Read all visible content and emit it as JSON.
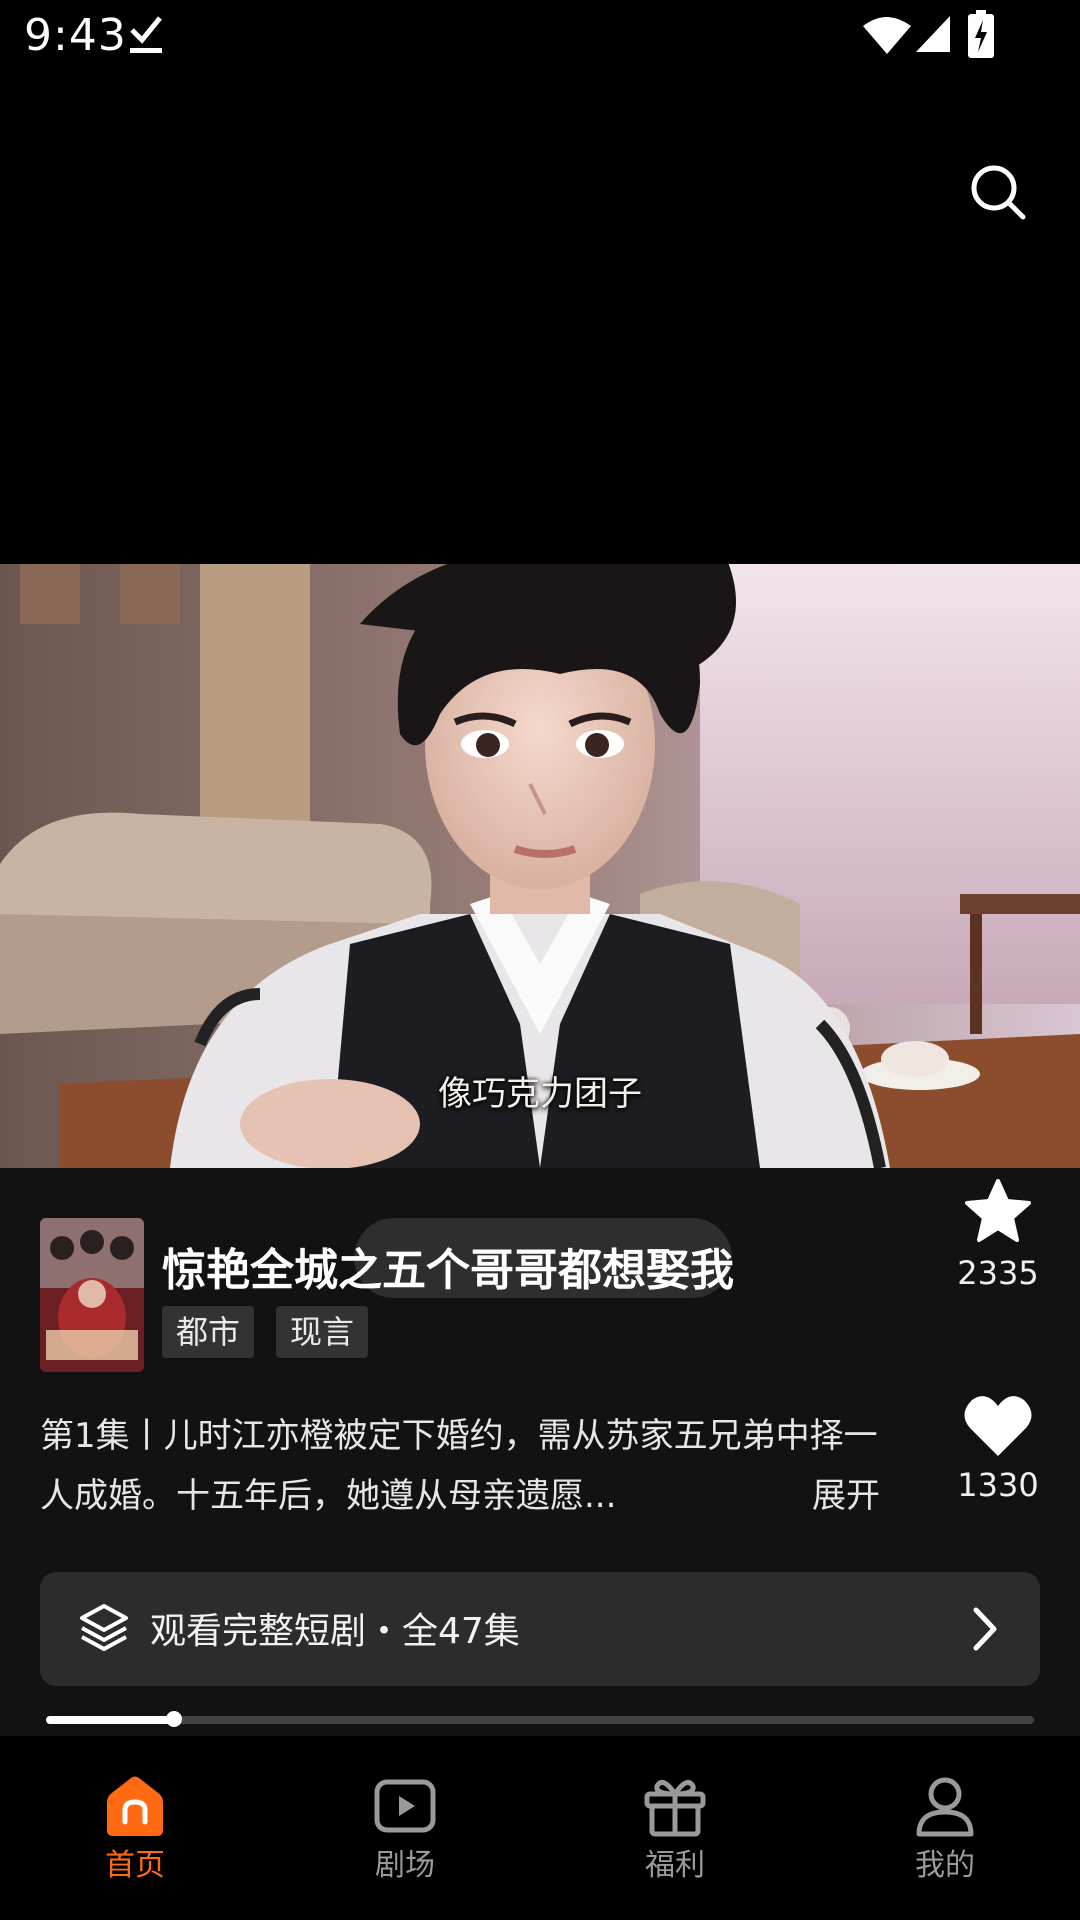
{
  "status_bar": {
    "time": "9:43"
  },
  "video": {
    "subtitle": "像巧克力团子"
  },
  "drama": {
    "title": "惊艳全城之五个哥哥都想娶我",
    "tags": [
      "都市",
      "现言"
    ],
    "description": "第1集丨儿时江亦橙被定下婚约，需从苏家五兄弟中择一人成婚。十五年后，她遵从母亲遗愿...",
    "expand_label": "展开"
  },
  "actions": {
    "favorite_count": "2335",
    "like_count": "1330"
  },
  "watch_full": {
    "label": "观看完整短剧・全47集"
  },
  "playback": {
    "progress": 0.13
  },
  "bottom_nav": [
    {
      "label": "首页",
      "icon": "home-icon",
      "active": true
    },
    {
      "label": "剧场",
      "icon": "play-square-icon",
      "active": false
    },
    {
      "label": "福利",
      "icon": "gift-icon",
      "active": false
    },
    {
      "label": "我的",
      "icon": "profile-icon",
      "active": false
    }
  ],
  "colors": {
    "accent": "#ff6a13",
    "panel_bg": "#121212",
    "button_bg": "#2c2c2c"
  }
}
